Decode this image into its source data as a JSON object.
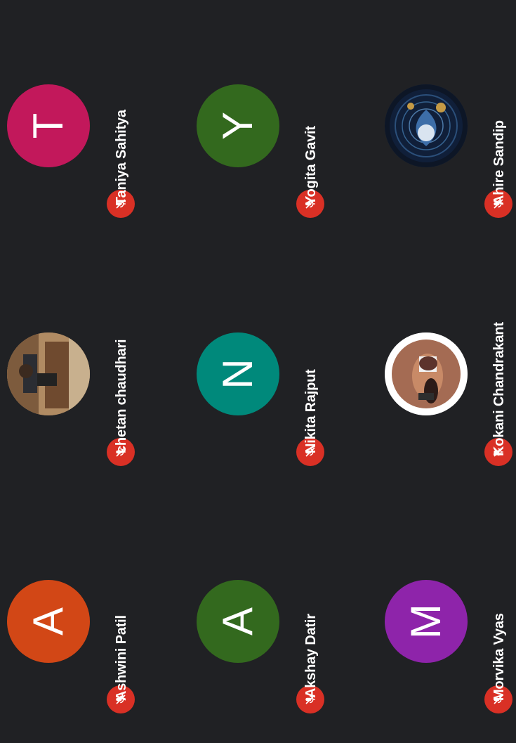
{
  "participants": [
    {
      "name": "Taniya Sahitya",
      "initial": "T",
      "color": "#c2185b",
      "avatar_type": "initial",
      "mic": "muted"
    },
    {
      "name": "chetan chaudhari",
      "initial": "",
      "color": "#8a6b4a",
      "avatar_type": "photo",
      "mic": "muted"
    },
    {
      "name": "Ashwini Patil",
      "initial": "A",
      "color": "#d24716",
      "avatar_type": "initial",
      "mic": "muted"
    },
    {
      "name": "Yogita Gavit",
      "initial": "Y",
      "color": "#33691e",
      "avatar_type": "initial",
      "mic": "muted"
    },
    {
      "name": "Nikita Rajput",
      "initial": "N",
      "color": "#00897b",
      "avatar_type": "initial",
      "mic": "muted"
    },
    {
      "name": "Akshay Datir",
      "initial": "A",
      "color": "#33691e",
      "avatar_type": "initial",
      "mic": "muted"
    },
    {
      "name": "Ahire Sandip",
      "initial": "",
      "color": "#10233f",
      "avatar_type": "photo",
      "mic": "muted"
    },
    {
      "name": "Kokani Chandrakant",
      "initial": "",
      "color": "#ffffff",
      "avatar_type": "photo",
      "mic": "muted"
    },
    {
      "name": "Morvika Vyas",
      "initial": "M",
      "color": "#8e24aa",
      "avatar_type": "initial",
      "mic": "muted"
    }
  ],
  "icons": {
    "mic_muted": "mic-off-icon"
  }
}
